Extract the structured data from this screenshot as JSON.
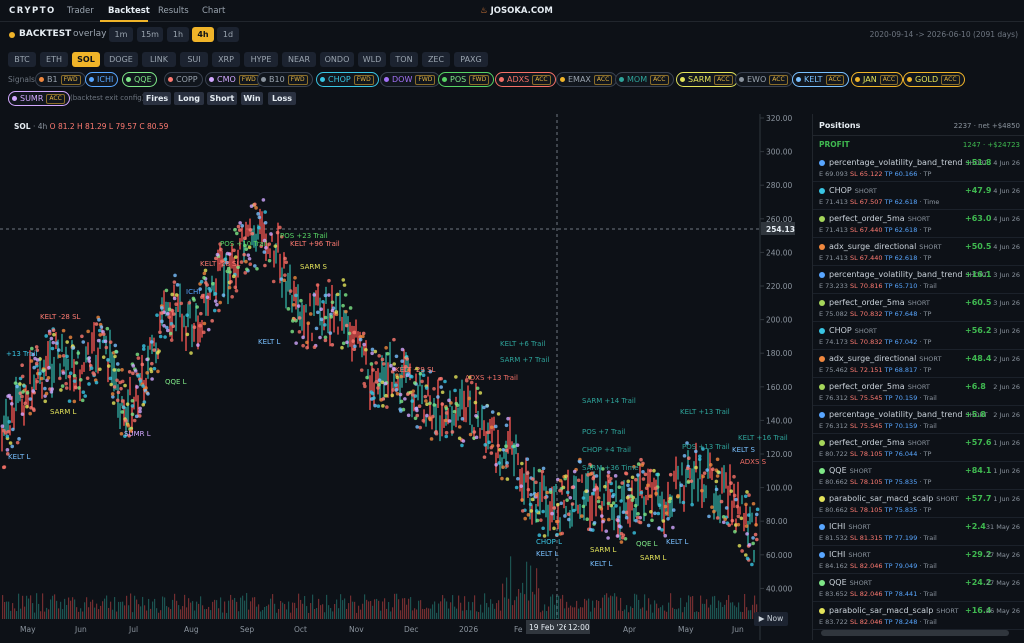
{
  "nav": {
    "brand": "CRYPTO",
    "tabs": [
      "Trader",
      "Backtest",
      "Results",
      "Chart"
    ],
    "site": "JOSOKA.COM"
  },
  "mode": {
    "title": "BACKTEST",
    "sub": "overlay",
    "intervals": [
      "1m",
      "15m",
      "1h",
      "4h",
      "1d"
    ],
    "active_interval": "4h",
    "range": "2020-09-14 -> 2026-06-10 (2091 days)"
  },
  "symbols": [
    "BTC",
    "ETH",
    "SOL",
    "DOGE",
    "LINK",
    "SUI",
    "XRP",
    "HYPE",
    "NEAR",
    "ONDO",
    "WLD",
    "TON",
    "ZEC",
    "PAXG"
  ],
  "active_symbol": "SOL",
  "signals_label": "Signals:",
  "signals": [
    {
      "name": "B1",
      "tag": "FWD",
      "color": "#f0883e"
    },
    {
      "name": "ICHI",
      "tag": "",
      "color": "#58a6ff"
    },
    {
      "name": "QQE",
      "tag": "",
      "color": "#7ee787"
    },
    {
      "name": "COPP",
      "tag": "",
      "color": "#ff7b72"
    },
    {
      "name": "CMO",
      "tag": "FWD",
      "color": "#d2a8ff"
    },
    {
      "name": "B10",
      "tag": "FWD",
      "color": "#8b949e"
    },
    {
      "name": "CHOP",
      "tag": "FWD",
      "color": "#39c5e3"
    },
    {
      "name": "DOW",
      "tag": "FWD",
      "color": "#a371f7"
    },
    {
      "name": "POS",
      "tag": "FWD",
      "color": "#56d364"
    },
    {
      "name": "ADXS",
      "tag": "ACC",
      "color": "#f47067"
    },
    {
      "name": "EMAX",
      "tag": "ACC",
      "color": "#f0b429"
    },
    {
      "name": "MOM",
      "tag": "ACC",
      "color": "#2ea39a"
    },
    {
      "name": "SARM",
      "tag": "ACC",
      "color": "#e3e35a"
    },
    {
      "name": "EWO",
      "tag": "ACC",
      "color": "#8b949e"
    },
    {
      "name": "KELT",
      "tag": "ACC",
      "color": "#79c0ff"
    },
    {
      "name": "JAN",
      "tag": "ACC",
      "color": "#f0b429"
    },
    {
      "name": "GOLD",
      "tag": "ACC",
      "color": "#f0b429"
    },
    {
      "name": "SUMR",
      "tag": "ACC",
      "color": "#d2a8ff"
    }
  ],
  "exit_note": "(backtest exit config)",
  "filters": [
    "Fires",
    "Long",
    "Short",
    "Win",
    "Loss"
  ],
  "ohlc": {
    "symbol": "SOL",
    "tf": "4h",
    "text": "O 81.2 H 81.29 L 79.57 C 80.59"
  },
  "y_ticks": [
    "320.00",
    "300.00",
    "280.00",
    "260.00",
    "240.00",
    "220.00",
    "200.00",
    "180.00",
    "160.00",
    "140.00",
    "120.00",
    "100.00",
    "80.00",
    "60.000",
    "40.000"
  ],
  "crosshair_price": "254.13",
  "x_ticks": [
    "May",
    "Jun",
    "Jul",
    "Aug",
    "Sep",
    "Oct",
    "Nov",
    "Dec",
    "2026",
    "Fe",
    "Mar",
    "Apr",
    "May",
    "Jun"
  ],
  "crosshair_date": "19 Feb '26",
  "crosshair_time": "12:00",
  "now_label": "Now",
  "chart_labels": [
    {
      "t": "KELT -28 SL",
      "c": "#ff7b72"
    },
    {
      "t": "+13 Trail",
      "c": "#39c5e3"
    },
    {
      "t": "SARM L",
      "c": "#e3e35a"
    },
    {
      "t": "SUMR L",
      "c": "#d2a8ff"
    },
    {
      "t": "KELT L",
      "c": "#79c0ff"
    },
    {
      "t": "POS +10 Trail",
      "c": "#56d364"
    },
    {
      "t": "POS +23 Trail",
      "c": "#56d364"
    },
    {
      "t": "KELT +96 Trail",
      "c": "#ff7b72"
    },
    {
      "t": "ICHI",
      "c": "#58a6ff"
    },
    {
      "t": "KELT -28 SL",
      "c": "#ff7b72"
    },
    {
      "t": "SARM S",
      "c": "#e3e35a"
    },
    {
      "t": "KELT L",
      "c": "#79c0ff"
    },
    {
      "t": "QQE L",
      "c": "#7ee787"
    },
    {
      "t": "KELT -29 SL",
      "c": "#ff7b72"
    },
    {
      "t": "ADXS +13 Trail",
      "c": "#f47067"
    },
    {
      "t": "KELT +6 Trail",
      "c": "#2ea39a"
    },
    {
      "t": "SARM +7 Trail",
      "c": "#2ea39a"
    },
    {
      "t": "SARM +14 Trail",
      "c": "#2ea39a"
    },
    {
      "t": "KELT +13 Trail",
      "c": "#2ea39a"
    },
    {
      "t": "POS +7 Trail",
      "c": "#2ea39a"
    },
    {
      "t": "CHOP +4 Trail",
      "c": "#2ea39a"
    },
    {
      "t": "SARM +36 Time",
      "c": "#2ea39a"
    },
    {
      "t": "POS +13 Trail",
      "c": "#2ea39a"
    },
    {
      "t": "KELT +16 Trail",
      "c": "#2ea39a"
    },
    {
      "t": "KELT S",
      "c": "#79c0ff"
    },
    {
      "t": "ADXS S",
      "c": "#f47067"
    },
    {
      "t": "CHOP L",
      "c": "#39c5e3"
    },
    {
      "t": "KELT L",
      "c": "#79c0ff"
    },
    {
      "t": "SARM L",
      "c": "#e3e35a"
    },
    {
      "t": "KELT L",
      "c": "#79c0ff"
    },
    {
      "t": "QQE L",
      "c": "#7ee787"
    },
    {
      "t": "KELT L",
      "c": "#79c0ff"
    },
    {
      "t": "SARM L",
      "c": "#e3e35a"
    }
  ],
  "positions": {
    "title": "Positions",
    "summary": "2237 · net +$4850",
    "group": "PROFIT",
    "group_summary": "1247 · +$24723",
    "items": [
      {
        "name": "percentage_volatility_band_trend",
        "side": "SHORT",
        "pnl": "+51.8",
        "date": "4 Jun 26",
        "e": "E 69.093",
        "sl": "SL 65.122",
        "tp": "TP 60.166",
        "exit": "· TP",
        "color": "#58a6ff"
      },
      {
        "name": "CHOP",
        "side": "SHORT",
        "pnl": "+47.9",
        "date": "4 Jun 26",
        "e": "E 71.413",
        "sl": "SL 67.507",
        "tp": "TP 62.618",
        "exit": "· Time",
        "color": "#39c5e3"
      },
      {
        "name": "perfect_order_5ma",
        "side": "SHORT",
        "pnl": "+63.0",
        "date": "4 Jun 26",
        "e": "E 71.413",
        "sl": "SL 67.440",
        "tp": "TP 62.618",
        "exit": "· TP",
        "color": "#a5d65a"
      },
      {
        "name": "adx_surge_directional",
        "side": "SHORT",
        "pnl": "+50.5",
        "date": "4 Jun 26",
        "e": "E 71.413",
        "sl": "SL 67.440",
        "tp": "TP 62.618",
        "exit": "· TP",
        "color": "#f0883e"
      },
      {
        "name": "percentage_volatility_band_trend",
        "side": "SHORT",
        "pnl": "+16.1",
        "date": "3 Jun 26",
        "e": "E 73.233",
        "sl": "SL 70.816",
        "tp": "TP 65.710",
        "exit": "· Trail",
        "color": "#58a6ff"
      },
      {
        "name": "perfect_order_5ma",
        "side": "SHORT",
        "pnl": "+60.5",
        "date": "3 Jun 26",
        "e": "E 75.082",
        "sl": "SL 70.832",
        "tp": "TP 67.648",
        "exit": "· TP",
        "color": "#a5d65a"
      },
      {
        "name": "CHOP",
        "side": "SHORT",
        "pnl": "+56.2",
        "date": "3 Jun 26",
        "e": "E 74.173",
        "sl": "SL 70.832",
        "tp": "TP 67.042",
        "exit": "· TP",
        "color": "#39c5e3"
      },
      {
        "name": "adx_surge_directional",
        "side": "SHORT",
        "pnl": "+48.4",
        "date": "2 Jun 26",
        "e": "E 75.462",
        "sl": "SL 72.151",
        "tp": "TP 68.817",
        "exit": "· TP",
        "color": "#f0883e"
      },
      {
        "name": "perfect_order_5ma",
        "side": "SHORT",
        "pnl": "+6.8",
        "date": "2 Jun 26",
        "e": "E 76.312",
        "sl": "SL 75.545",
        "tp": "TP 70.159",
        "exit": "· Trail",
        "color": "#a5d65a"
      },
      {
        "name": "percentage_volatility_band_trend",
        "side": "SHORT",
        "pnl": "+5.8",
        "date": "2 Jun 26",
        "e": "E 76.312",
        "sl": "SL 75.545",
        "tp": "TP 70.159",
        "exit": "· Trail",
        "color": "#58a6ff"
      },
      {
        "name": "perfect_order_5ma",
        "side": "SHORT",
        "pnl": "+57.6",
        "date": "1 Jun 26",
        "e": "E 80.722",
        "sl": "SL 78.105",
        "tp": "TP 76.044",
        "exit": "· TP",
        "color": "#a5d65a"
      },
      {
        "name": "QQE",
        "side": "SHORT",
        "pnl": "+84.1",
        "date": "1 Jun 26",
        "e": "E 80.662",
        "sl": "SL 78.105",
        "tp": "TP 75.835",
        "exit": "· TP",
        "color": "#7ee787"
      },
      {
        "name": "parabolic_sar_macd_scalp",
        "side": "SHORT",
        "pnl": "+57.7",
        "date": "1 Jun 26",
        "e": "E 80.662",
        "sl": "SL 78.105",
        "tp": "TP 75.835",
        "exit": "· TP",
        "color": "#e3e35a"
      },
      {
        "name": "ICHI",
        "side": "SHORT",
        "pnl": "+2.4",
        "date": "31 May 26",
        "e": "E 81.532",
        "sl": "SL 81.315",
        "tp": "TP 77.199",
        "exit": "· Trail",
        "color": "#58a6ff"
      },
      {
        "name": "ICHI",
        "side": "SHORT",
        "pnl": "+29.2",
        "date": "27 May 26",
        "e": "E 84.162",
        "sl": "SL 82.046",
        "tp": "TP 79.049",
        "exit": "· Trail",
        "color": "#58a6ff"
      },
      {
        "name": "QQE",
        "side": "SHORT",
        "pnl": "+24.2",
        "date": "27 May 26",
        "e": "E 83.652",
        "sl": "SL 82.046",
        "tp": "TP 78.441",
        "exit": "· Trail",
        "color": "#7ee787"
      },
      {
        "name": "parabolic_sar_macd_scalp",
        "side": "SHORT",
        "pnl": "+16.4",
        "date": "26 May 26",
        "e": "E 83.722",
        "sl": "SL 82.046",
        "tp": "TP 78.248",
        "exit": "· Trail",
        "color": "#e3e35a"
      }
    ]
  }
}
